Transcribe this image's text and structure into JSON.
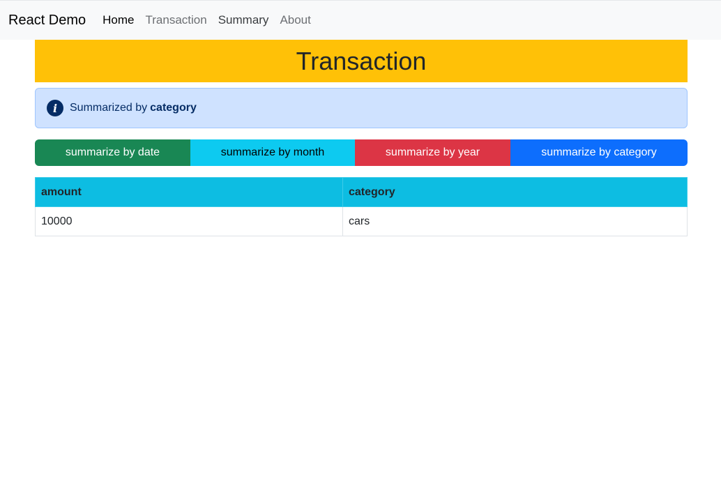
{
  "navbar": {
    "brand": "React Demo",
    "links": [
      {
        "label": "Home"
      },
      {
        "label": "Transaction"
      },
      {
        "label": "Summary"
      },
      {
        "label": "About"
      }
    ]
  },
  "page": {
    "title": "Transaction"
  },
  "alert": {
    "icon": "info-icon",
    "prefix": "Summarized by",
    "value": "category",
    "color": "#cfe2ff"
  },
  "summarize_buttons": [
    {
      "label": "summarize by date",
      "color": "#198754"
    },
    {
      "label": "summarize by month",
      "color": "#0dcaf0"
    },
    {
      "label": "summarize by year",
      "color": "#dc3545"
    },
    {
      "label": "summarize by category",
      "color": "#0d6efd"
    }
  ],
  "table": {
    "headers": [
      "amount",
      "category"
    ],
    "rows": [
      [
        "10000",
        "cars"
      ]
    ]
  }
}
